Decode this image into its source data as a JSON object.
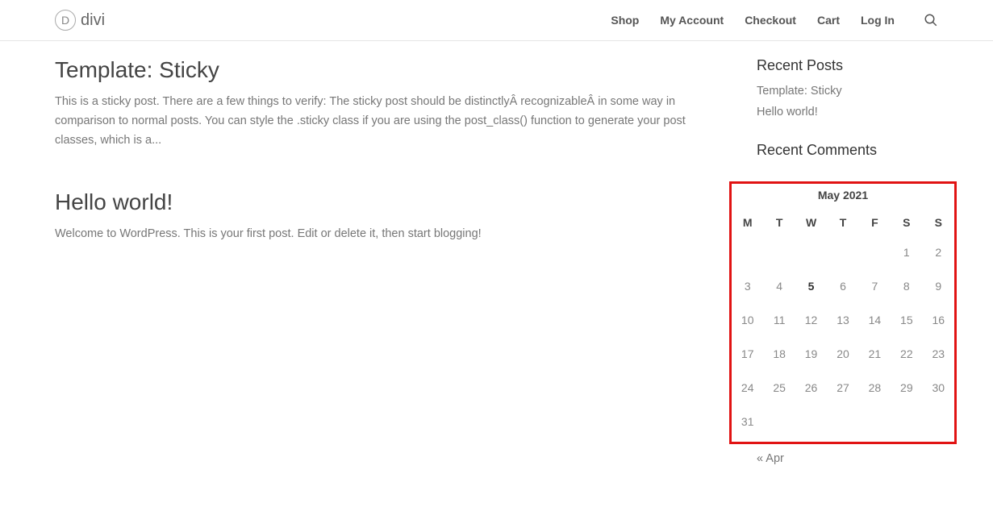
{
  "logo": {
    "mark": "D",
    "text": "divi"
  },
  "nav": {
    "shop": "Shop",
    "my_account": "My Account",
    "checkout": "Checkout",
    "cart": "Cart",
    "log_in": "Log In"
  },
  "posts": [
    {
      "title": "Template: Sticky",
      "excerpt": "This is a sticky post. There are a few things to verify: The sticky post should be distinctlyÂ recognizableÂ in some way in comparison to normal posts. You can style the .sticky class if you are using the post_class() function to generate your post classes, which is a..."
    },
    {
      "title": "Hello world!",
      "excerpt": "Welcome to WordPress. This is your first post. Edit or delete it, then start blogging!"
    }
  ],
  "sidebar": {
    "recent_posts": {
      "title": "Recent Posts",
      "items": [
        "Template: Sticky",
        "Hello world!"
      ]
    },
    "recent_comments": {
      "title": "Recent Comments"
    },
    "calendar": {
      "caption": "May 2021",
      "day_headers": [
        "M",
        "T",
        "W",
        "T",
        "F",
        "S",
        "S"
      ],
      "weeks": [
        [
          "",
          "",
          "",
          "",
          "",
          "1",
          "2"
        ],
        [
          "3",
          "4",
          "5",
          "6",
          "7",
          "8",
          "9"
        ],
        [
          "10",
          "11",
          "12",
          "13",
          "14",
          "15",
          "16"
        ],
        [
          "17",
          "18",
          "19",
          "20",
          "21",
          "22",
          "23"
        ],
        [
          "24",
          "25",
          "26",
          "27",
          "28",
          "29",
          "30"
        ],
        [
          "31",
          "",
          "",
          "",
          "",
          "",
          ""
        ]
      ],
      "today": "5",
      "prev_link": "« Apr"
    }
  }
}
